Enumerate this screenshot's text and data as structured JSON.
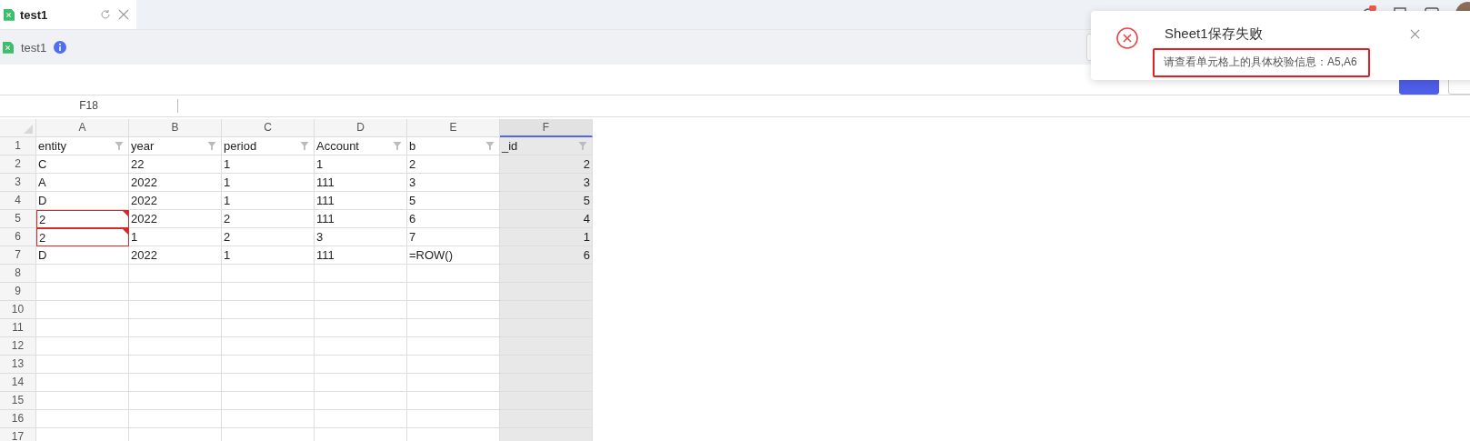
{
  "tab": {
    "label": "test1"
  },
  "header": {
    "title": "test1"
  },
  "toolbar": {
    "buttons": [
      {
        "kind": "primary"
      },
      {
        "kind": "default"
      }
    ]
  },
  "name_box": "F18",
  "columns": [
    {
      "label": "A",
      "selected": false
    },
    {
      "label": "B",
      "selected": false
    },
    {
      "label": "C",
      "selected": false
    },
    {
      "label": "D",
      "selected": false
    },
    {
      "label": "E",
      "selected": false
    },
    {
      "label": "F",
      "selected": true
    }
  ],
  "header_row": {
    "number": "1",
    "cells": [
      "entity",
      "year",
      "period",
      "Account",
      "b",
      "_id"
    ]
  },
  "rows": [
    {
      "number": "2",
      "a_cell_invalid": false,
      "cells": [
        "C",
        "22",
        "1",
        "1",
        "2",
        "2"
      ]
    },
    {
      "number": "3",
      "a_cell_invalid": false,
      "cells": [
        "A",
        "2022",
        "1",
        "111",
        "3",
        "3"
      ]
    },
    {
      "number": "4",
      "a_cell_invalid": false,
      "cells": [
        "D",
        "2022",
        "1",
        "111",
        "5",
        "5"
      ]
    },
    {
      "number": "5",
      "a_cell_invalid": true,
      "cells": [
        "2",
        "2022",
        "2",
        "111",
        "6",
        "4"
      ]
    },
    {
      "number": "6",
      "a_cell_invalid": true,
      "cells": [
        "2",
        "1",
        "2",
        "3",
        "7",
        "1"
      ]
    },
    {
      "number": "7",
      "a_cell_invalid": false,
      "cells": [
        "D",
        "2022",
        "1",
        "111",
        "=ROW()",
        "6"
      ]
    }
  ],
  "empty_row_numbers": [
    "8",
    "9",
    "10",
    "11",
    "12",
    "13",
    "14",
    "15",
    "16",
    "17"
  ],
  "toast": {
    "title": "Sheet1保存失败",
    "message": "请查看单元格上的具体校验信息：A5,A6"
  }
}
